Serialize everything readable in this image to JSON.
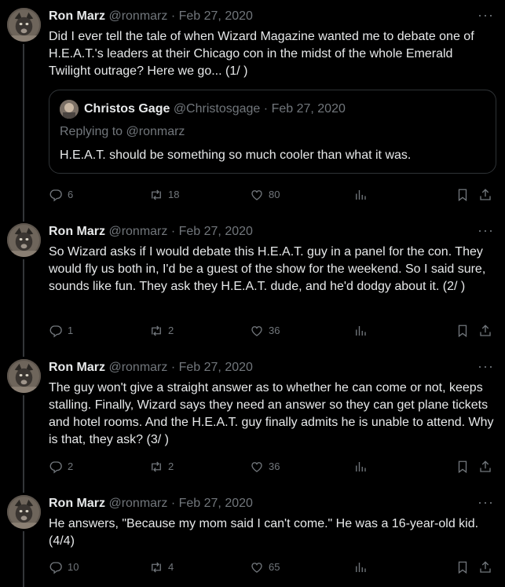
{
  "tweets": [
    {
      "author": {
        "name": "Ron Marz",
        "handle": "@ronmarz"
      },
      "separator": "·",
      "date": "Feb 27, 2020",
      "text": "Did I ever tell the tale of when Wizard Magazine wanted me to debate one of H.E.A.T.'s leaders at their Chicago con in the midst of the whole Emerald Twilight outrage? Here we go... (1/ )",
      "quote": {
        "author": {
          "name": "Christos Gage",
          "handle": "@Christosgage"
        },
        "separator": "·",
        "date": "Feb 27, 2020",
        "replying_to": "Replying to @ronmarz",
        "text": "H.E.A.T. should be something so much cooler than what it was."
      },
      "stats": {
        "replies": "6",
        "retweets": "18",
        "likes": "80"
      }
    },
    {
      "author": {
        "name": "Ron Marz",
        "handle": "@ronmarz"
      },
      "separator": "·",
      "date": "Feb 27, 2020",
      "text": "So Wizard asks if I would debate this H.E.A.T. guy in a panel for the con. They would fly us both in, I'd be a guest of the show for the weekend. So I said sure, sounds like fun. They ask they H.E.A.T. dude, and he'd dodgy about it. (2/ )",
      "stats": {
        "replies": "1",
        "retweets": "2",
        "likes": "36"
      }
    },
    {
      "author": {
        "name": "Ron Marz",
        "handle": "@ronmarz"
      },
      "separator": "·",
      "date": "Feb 27, 2020",
      "text": "The guy won't give a straight answer as to whether he can come or not, keeps stalling. Finally, Wizard says they need an answer so they can get plane tickets and hotel rooms. And the H.E.A.T. guy finally admits he is unable to attend. Why is that, they ask? (3/ )",
      "stats": {
        "replies": "2",
        "retweets": "2",
        "likes": "36"
      }
    },
    {
      "author": {
        "name": "Ron Marz",
        "handle": "@ronmarz"
      },
      "separator": "·",
      "date": "Feb 27, 2020",
      "text": "He answers, \"Because my mom said I can't come.\" He was a 16-year-old kid. (4/4)",
      "stats": {
        "replies": "10",
        "retweets": "4",
        "likes": "65"
      }
    }
  ],
  "more_label": "···",
  "icons": [
    "reply-icon",
    "retweet-icon",
    "like-icon",
    "views-icon",
    "bookmark-icon",
    "share-icon",
    "more-icon"
  ],
  "colors": {
    "background": "#000000",
    "text": "#e7e9ea",
    "muted": "#71767b",
    "border": "#2f3336"
  }
}
